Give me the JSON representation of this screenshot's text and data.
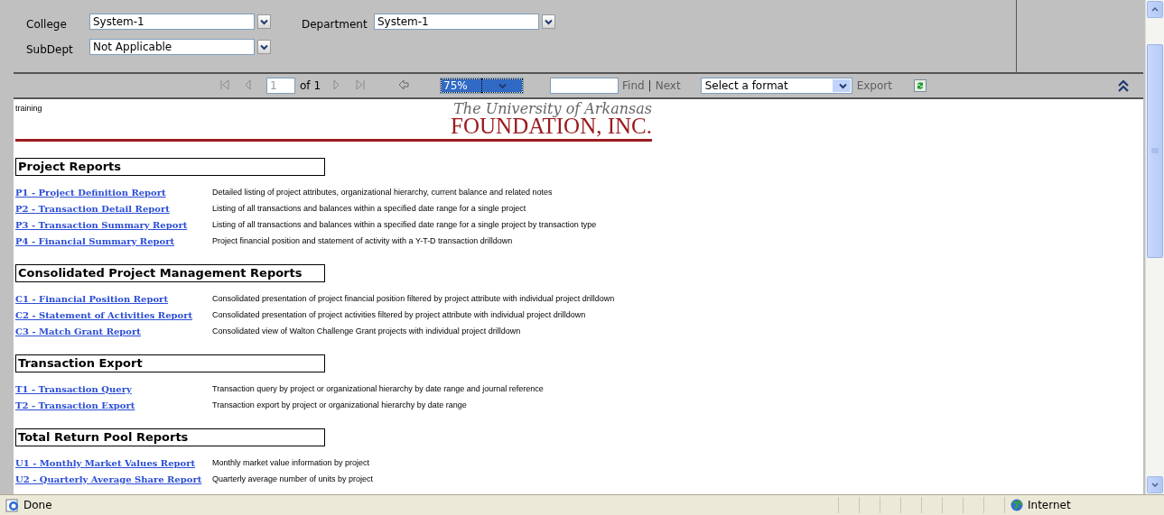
{
  "parameters": [
    {
      "label": "College",
      "value": "System-1"
    },
    {
      "label": "Department",
      "value": "System-1"
    },
    {
      "label": "SubDept",
      "value": "Not Applicable"
    }
  ],
  "toolbar": {
    "navigation": [
      {
        "kind": "first",
        "disabled": true
      },
      {
        "kind": "previous",
        "disabled": true
      },
      {
        "kind": "next",
        "disabled": true
      },
      {
        "kind": "last",
        "disabled": true
      }
    ],
    "page": "1",
    "page_count": "of 1",
    "zoom": "75%",
    "find": {
      "label": "Find",
      "disabled": true
    },
    "separator": "|",
    "find_next": {
      "label": "Next",
      "disabled": true
    },
    "format": "Select a format",
    "export": {
      "label": "Export",
      "disabled": true
    }
  },
  "report": {
    "user": "training",
    "logo": {
      "line1": "The University of Arkansas",
      "line2": "FOUNDATION, INC."
    },
    "sections": [
      {
        "title": "Project Reports",
        "items": [
          {
            "link": "P1 - Project Definition Report",
            "description": "Detailed listing of project attributes, organizational hierarchy, current balance and related notes"
          },
          {
            "link": "P2 - Transaction Detail Report",
            "description": "Listing of all transactions and balances within a specified date range for a single project"
          },
          {
            "link": "P3 - Transaction Summary Report",
            "description": "Listing of all transactions and balances within a specified date range for a single project by transaction type"
          },
          {
            "link": "P4 - Financial Summary Report",
            "description": "Project financial position and statement of activity with a Y-T-D transaction drilldown"
          }
        ]
      },
      {
        "title": "Consolidated Project Management Reports",
        "items": [
          {
            "link": "C1 - Financial Position Report",
            "description": "Consolidated presentation of project financial position filtered by project attribute with individual project drilldown"
          },
          {
            "link": "C2 - Statement of Activities Report",
            "description": "Consolidated presentation of project activities filtered by project attribute with individual project drilldown"
          },
          {
            "link": "C3 - Match Grant Report",
            "description": "Consolidated view of Walton Challenge Grant projects with individual project drilldown"
          }
        ]
      },
      {
        "title": "Transaction Export",
        "items": [
          {
            "link": "T1 - Transaction Query",
            "description": "Transaction query by project or organizational hierarchy by date range and journal reference"
          },
          {
            "link": "T2 - Transaction Export",
            "description": "Transaction export by project or organizational hierarchy by date range"
          }
        ]
      },
      {
        "title": "Total Return Pool Reports",
        "items": [
          {
            "link": "U1 - Monthly Market Values Report",
            "description": "Monthly market value information by project"
          },
          {
            "link": "U2 - Quarterly Average Share Report",
            "description": "Quarterly average number of units by project"
          }
        ]
      }
    ]
  },
  "status_bar": {
    "text": "Done",
    "zone": "Internet"
  }
}
